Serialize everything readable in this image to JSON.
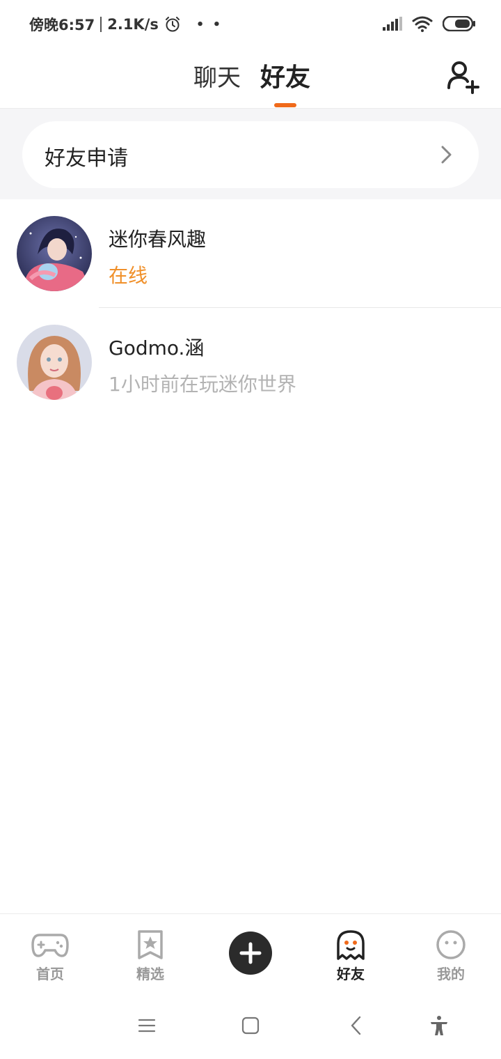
{
  "status_bar": {
    "time": "傍晚6:57",
    "net_speed": "2.1K/s",
    "extra_dots": "• •"
  },
  "header": {
    "tabs": [
      {
        "label": "聊天",
        "active": false
      },
      {
        "label": "好友",
        "active": true
      }
    ],
    "accent_color": "#f06a1a"
  },
  "friend_request": {
    "label": "好友申请"
  },
  "friends": [
    {
      "name": "迷你春风趣",
      "status": "在线",
      "online": true
    },
    {
      "name": "Godmo.涵",
      "status": "1小时前在玩迷你世界",
      "online": false
    }
  ],
  "bottom_nav": {
    "items": [
      {
        "label": "首页",
        "icon": "gamepad-icon"
      },
      {
        "label": "精选",
        "icon": "star-bookmark-icon"
      },
      {
        "label": "",
        "icon": "plus-icon"
      },
      {
        "label": "好友",
        "icon": "ghost-icon",
        "active": true
      },
      {
        "label": "我的",
        "icon": "smiley-face-icon"
      }
    ]
  },
  "system_nav": [
    "menu-icon",
    "home-square-icon",
    "back-icon",
    "accessibility-icon"
  ]
}
